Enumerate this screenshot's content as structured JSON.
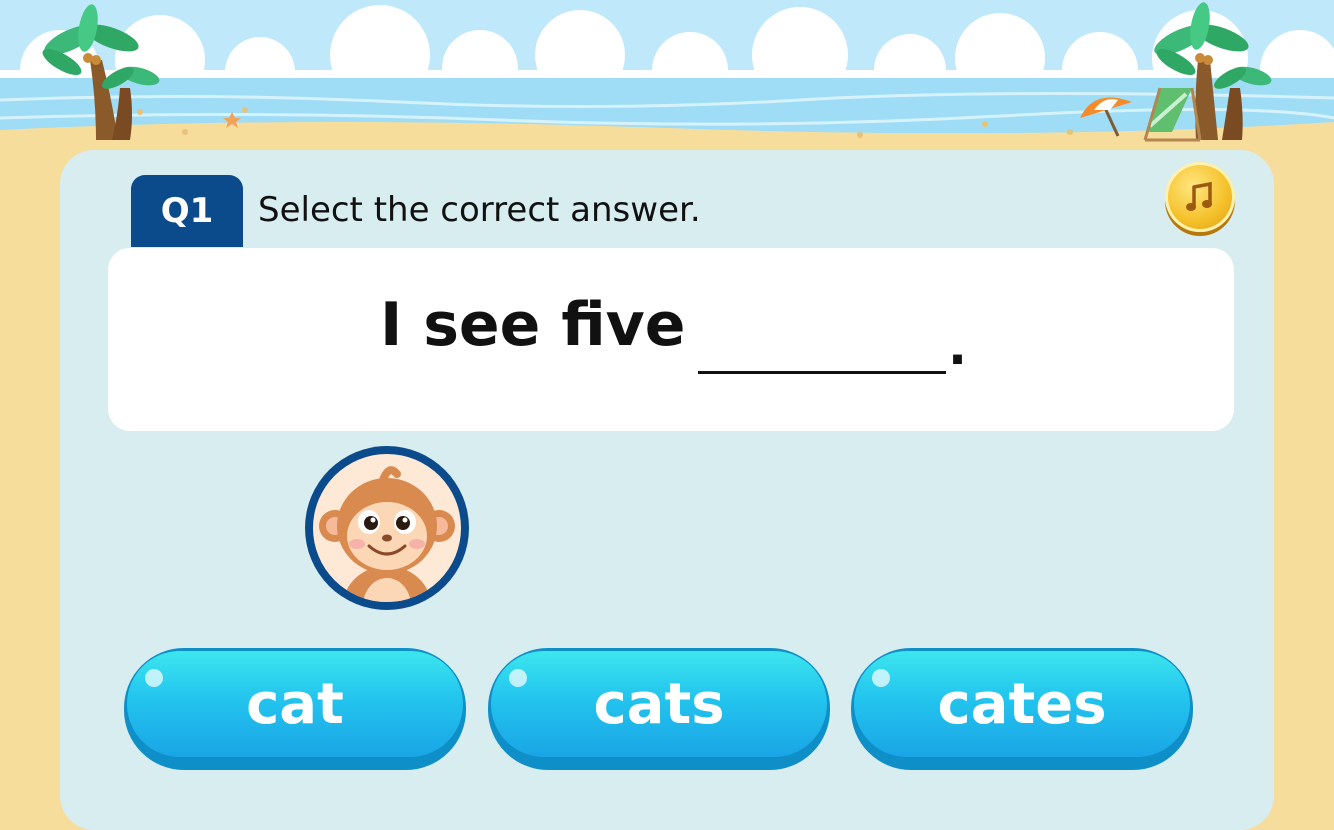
{
  "question": {
    "number_label": "Q1",
    "instruction": "Select the correct answer.",
    "sentence": "I see five",
    "blank_end": "."
  },
  "audio_button": {
    "icon": "music-note-icon"
  },
  "answers": [
    {
      "label": "cat"
    },
    {
      "label": "cats"
    },
    {
      "label": "cates"
    }
  ],
  "colors": {
    "badge": "#0b4b8c",
    "panel": "#d8edf0",
    "button": "#23c4ee",
    "sand": "#f7dd9c",
    "sky": "#bfe8fb"
  }
}
